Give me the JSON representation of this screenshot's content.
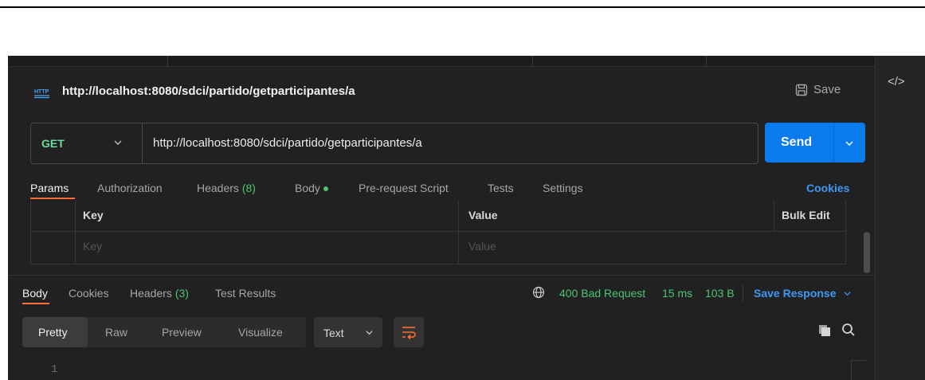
{
  "request": {
    "title": "http://localhost:8080/sdci/partido/getparticipantes/a",
    "save_label": "Save",
    "method": "GET",
    "url": "http://localhost:8080/sdci/partido/getparticipantes/a",
    "send_label": "Send"
  },
  "request_tabs": {
    "params": "Params",
    "authorization": "Authorization",
    "headers": "Headers",
    "headers_count": "(8)",
    "body": "Body",
    "pre_request": "Pre-request Script",
    "tests": "Tests",
    "settings": "Settings",
    "cookies": "Cookies"
  },
  "params_table": {
    "key_header": "Key",
    "value_header": "Value",
    "bulk_edit": "Bulk Edit",
    "key_placeholder": "Key",
    "value_placeholder": "Value"
  },
  "response_tabs": {
    "body": "Body",
    "cookies": "Cookies",
    "headers": "Headers",
    "headers_count": "(3)",
    "test_results": "Test Results"
  },
  "response_status": {
    "status": "400 Bad Request",
    "time": "15 ms",
    "size": "103 B",
    "save_response": "Save Response"
  },
  "view_modes": {
    "pretty": "Pretty",
    "raw": "Raw",
    "preview": "Preview",
    "visualize": "Visualize",
    "format": "Text"
  },
  "editor": {
    "line_1": "1"
  },
  "icons": {
    "http": "http-icon",
    "save": "save-icon",
    "code": "code-icon",
    "globe": "globe-icon",
    "wrap": "wrap-lines-icon",
    "copy": "copy-icon",
    "search": "search-icon"
  },
  "colors": {
    "accent_orange": "#ff6c37",
    "send_blue": "#097bed",
    "status_green": "#4cc472",
    "link_blue": "#3e97f5"
  }
}
